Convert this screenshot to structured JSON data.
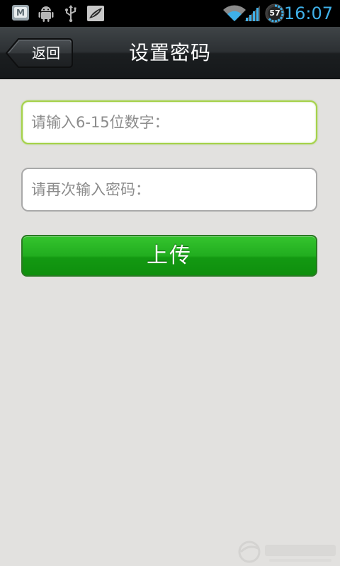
{
  "status_bar": {
    "time": "16:07",
    "battery_level": "57",
    "accent_color": "#3fb0e8",
    "icons": [
      "app-notification-icon",
      "android-icon",
      "usb-icon",
      "image-notification-icon",
      "wifi-icon",
      "signal-icon",
      "battery-icon"
    ]
  },
  "title_bar": {
    "back_label": "返回",
    "title": "设置密码"
  },
  "form": {
    "password_placeholder": "请输入6-15位数字：",
    "confirm_placeholder": "请再次输入密码：",
    "submit_label": "上传",
    "submit_color": "#1faa1c",
    "focus_border_color": "#a6d24a"
  },
  "colors": {
    "background": "#e2e1df",
    "status_bar": "#000000",
    "title_bar": "#2c3033"
  }
}
